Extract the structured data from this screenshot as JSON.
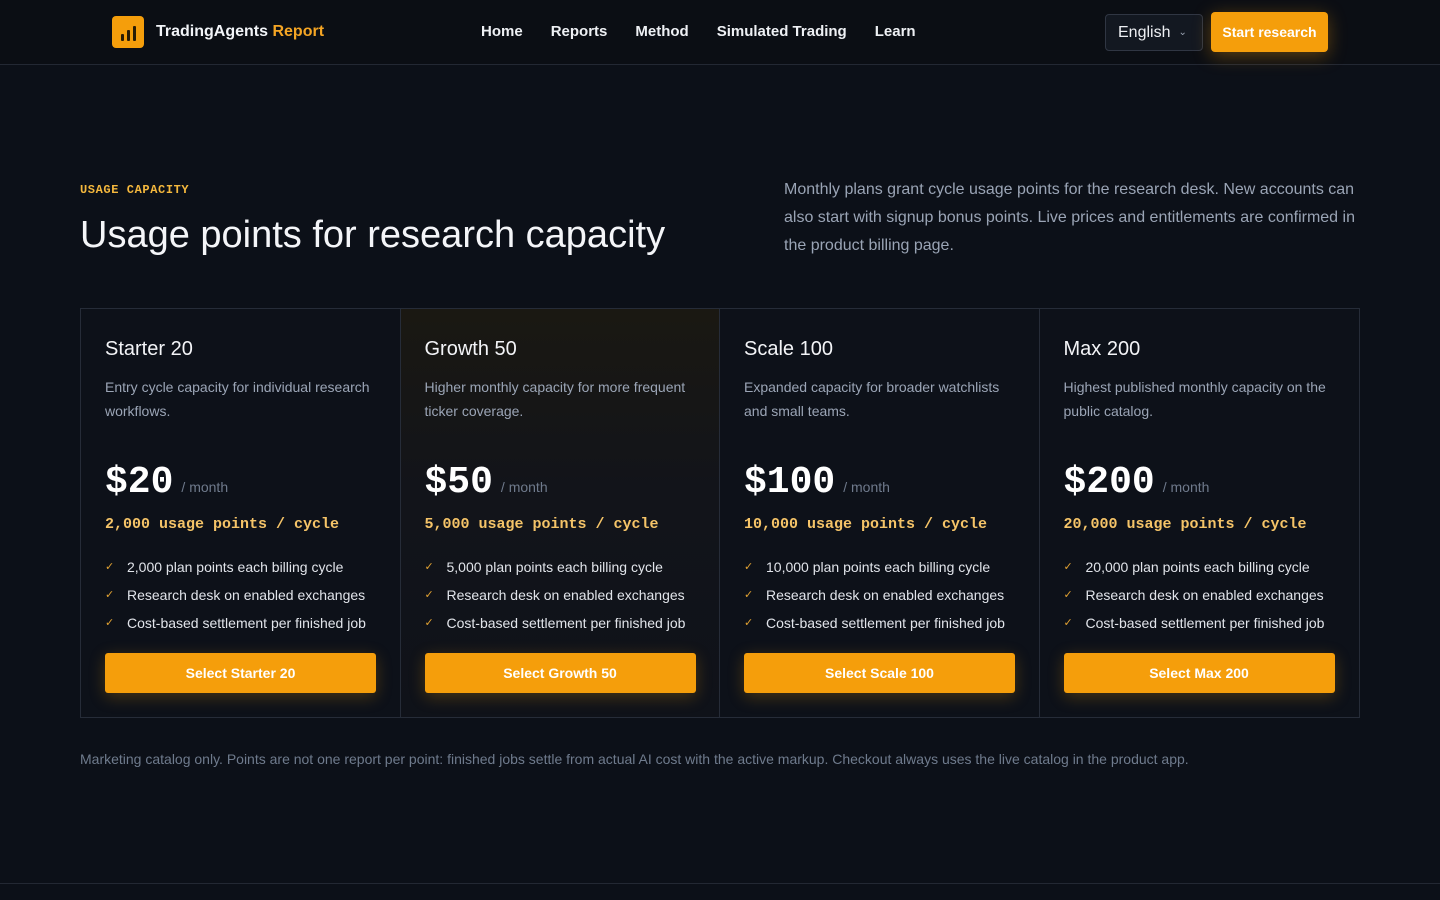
{
  "header": {
    "brand_name": "TradingAgents",
    "brand_accent": "Report",
    "logo_icon": "bar-chart-icon",
    "nav": [
      {
        "label": "Home"
      },
      {
        "label": "Reports"
      },
      {
        "label": "Method"
      },
      {
        "label": "Simulated Trading"
      },
      {
        "label": "Learn"
      }
    ],
    "language": "English",
    "cta_label": "Start research"
  },
  "hero": {
    "eyebrow": "USAGE CAPACITY",
    "title": "Usage points for research capacity",
    "intro": "Monthly plans grant cycle usage points for the research desk. New accounts can also start with signup bonus points. Live prices and entitlements are confirmed in the product billing page."
  },
  "plans": [
    {
      "name": "Starter 20",
      "description": "Entry cycle capacity for individual research workflows.",
      "price": "$20",
      "period": "/ month",
      "points": "2,000 usage points / cycle",
      "features": [
        "2,000 plan points each billing cycle",
        "Research desk on enabled exchanges",
        "Cost-based settlement per finished job"
      ],
      "button": "Select Starter 20"
    },
    {
      "name": "Growth 50",
      "description": "Higher monthly capacity for more frequent ticker coverage.",
      "price": "$50",
      "period": "/ month",
      "points": "5,000 usage points / cycle",
      "features": [
        "5,000 plan points each billing cycle",
        "Research desk on enabled exchanges",
        "Cost-based settlement per finished job"
      ],
      "button": "Select Growth 50"
    },
    {
      "name": "Scale 100",
      "description": "Expanded capacity for broader watchlists and small teams.",
      "price": "$100",
      "period": "/ month",
      "points": "10,000 usage points / cycle",
      "features": [
        "10,000 plan points each billing cycle",
        "Research desk on enabled exchanges",
        "Cost-based settlement per finished job"
      ],
      "button": "Select Scale 100"
    },
    {
      "name": "Max 200",
      "description": "Highest published monthly capacity on the public catalog.",
      "price": "$200",
      "period": "/ month",
      "points": "20,000 usage points / cycle",
      "features": [
        "20,000 plan points each billing cycle",
        "Research desk on enabled exchanges",
        "Cost-based settlement per finished job"
      ],
      "button": "Select Max 200"
    }
  ],
  "footnote": "Marketing catalog only. Points are not one report per point: finished jobs settle from actual AI cost with the active markup. Checkout always uses the live catalog in the product app.",
  "colors": {
    "background": "#0c1018",
    "accent": "#f59e0b",
    "points_text": "#f5c468"
  }
}
